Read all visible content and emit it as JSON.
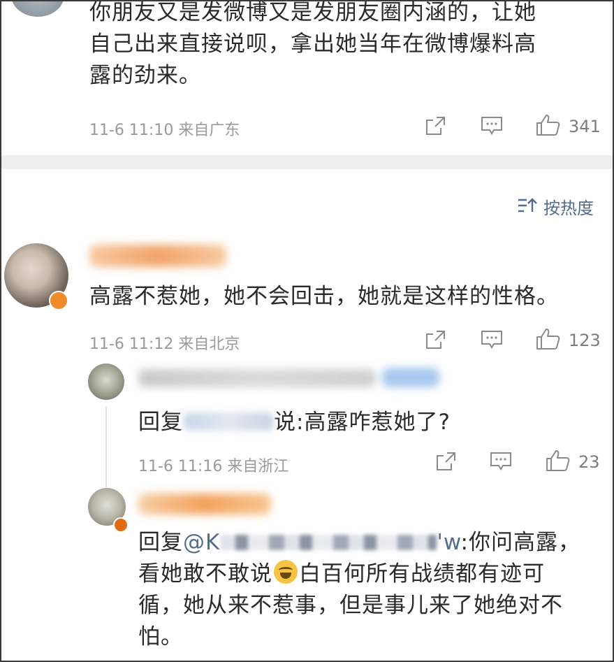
{
  "colors": {
    "background": "#ffffff",
    "divider": "#eeeeee",
    "meta_text": "#9a9a9a",
    "sort_text": "#566b8c",
    "mention": "#566b8c"
  },
  "top_comment": {
    "lines": [
      "你朋友又是发微博又是发朋友圈内涵的，让她",
      "自己出来直接说呗，拿出她当年在微博爆料高",
      "露的劲来。"
    ],
    "meta": "11-6 11:10 来自广东",
    "like_count": "341",
    "icons": [
      "share-icon",
      "comment-icon",
      "like-icon"
    ]
  },
  "sort": {
    "label": "按热度",
    "icon": "sort-icon"
  },
  "comments": [
    {
      "text": "高露不惹她，她不会回击，她就是这样的性格。",
      "meta": "11-6 11:12 来自北京",
      "like_count": "123"
    }
  ],
  "replies": [
    {
      "prefix": "回复",
      "suffix": "说:高露咋惹她了?",
      "meta": "11-6 11:16 来自浙江",
      "like_count": "23"
    },
    {
      "prefix": "回复",
      "mention_start": "@K",
      "mention_end": "'w",
      "text_line1": ":你问高露，",
      "text_line2a": "看她敢不敢说",
      "emoji": "laugh-cry-emoji",
      "text_line2b": "白百何所有战绩都有迹可",
      "text_line3": "循，她从来不惹事，但是事儿来了她绝对不",
      "text_line4": "怕。"
    }
  ]
}
